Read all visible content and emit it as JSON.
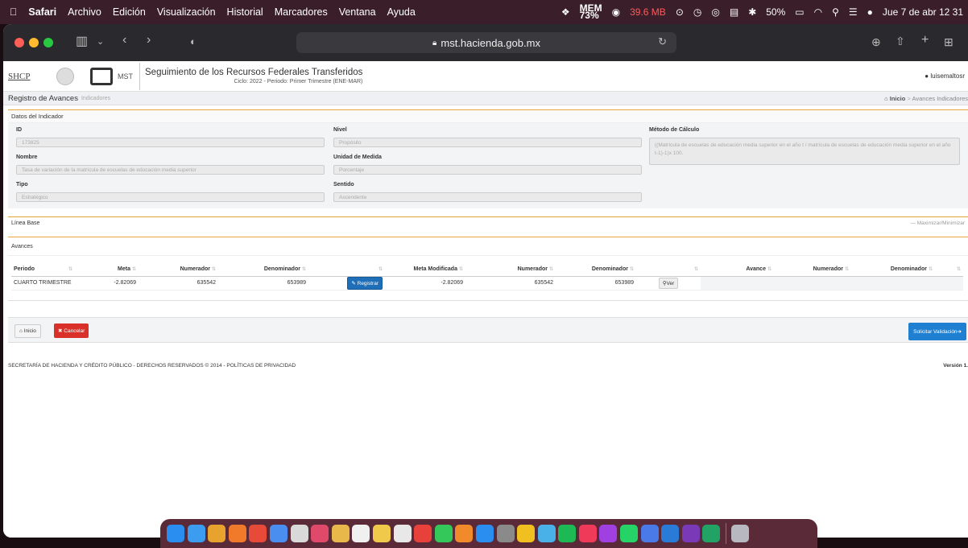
{
  "menubar": {
    "apple_icon": "apple-icon",
    "app": "Safari",
    "items": [
      "Archivo",
      "Edición",
      "Visualización",
      "Historial",
      "Marcadores",
      "Ventana",
      "Ayuda"
    ],
    "mem_label": "MEM",
    "mem_value": "73%",
    "mem_usage": "39.6 MB",
    "battery": "50%",
    "datetime": "Jue 7 de abr 12 31"
  },
  "browser": {
    "url": "mst.hacienda.gob.mx"
  },
  "header": {
    "shcp": "SHCP",
    "mst": "MST",
    "title": "Seguimiento de los Recursos Federales Transferidos",
    "subtitle": "Ciclo: 2022 - Periodo: Primer Trimestre (ENE-MAR)",
    "user": "luisemaltosr"
  },
  "breadcrumb": {
    "title": "Registro de Avances",
    "subtitle": "Indicadores",
    "home": "Inicio",
    "sep": ">",
    "current": "Avances Indicadores"
  },
  "datos": {
    "heading": "Datos del Indicador",
    "id_label": "ID",
    "id_value": "173825",
    "nombre_label": "Nombre",
    "nombre_value": "Tasa de variación de la matrícula de escuelas de educación media superior",
    "tipo_label": "Tipo",
    "tipo_value": "Estratégico",
    "nivel_label": "Nivel",
    "nivel_value": "Propósito",
    "unidad_label": "Unidad de Medida",
    "unidad_value": "Porcentaje",
    "sentido_label": "Sentido",
    "sentido_value": "Ascendente",
    "metodo_label": "Método de Cálculo",
    "metodo_value": "((Matrícula de escuelas de educación media superior en el año t / matrícula de escuelas de educación media superior en el año t-1)-1)x 100."
  },
  "linea_base": {
    "heading": "Línea Base",
    "toggle": "Maximizar/Minimizar"
  },
  "avances": {
    "heading": "Avances",
    "columns": [
      "Periodo",
      "Meta",
      "Numerador",
      "Denominador",
      "",
      "Meta Modificada",
      "Numerador",
      "Denominador",
      "",
      "Avance",
      "Numerador",
      "Denominador",
      ""
    ],
    "row": {
      "periodo": "CUARTO TRIMESTRE",
      "meta": "-2.82069",
      "numerador": "635542",
      "denominador": "653989",
      "registrar": "Registrar",
      "meta_mod": "-2.82069",
      "numerador2": "635542",
      "denominador2": "653989",
      "ver": "Ver"
    }
  },
  "actions": {
    "inicio": "Inicio",
    "cancelar": "Cancelar",
    "solicitar": "Solicitar Validación"
  },
  "footer": {
    "text": "SECRETARÍA DE HACIENDA Y CRÉDITO PÚBLICO - DERECHOS RESERVADOS © 2014 - POLÍTICAS DE PRIVACIDAD",
    "version": "Versión 1."
  },
  "colors": {
    "accent": "#e8a640",
    "blue": "#1f7fd0",
    "red": "#d9312a",
    "dock_blue": "#1f7fd0"
  }
}
